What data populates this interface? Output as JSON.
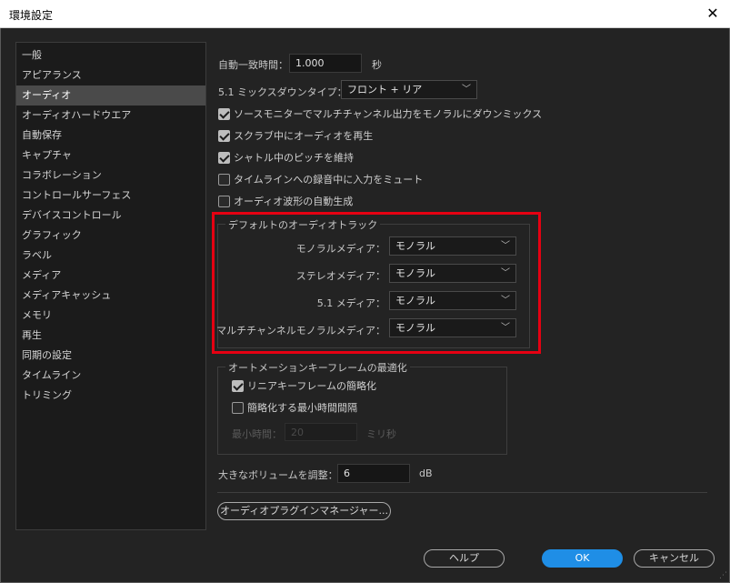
{
  "window": {
    "title": "環境設定",
    "close_glyph": "✕"
  },
  "sidebar": {
    "items": [
      {
        "label": "一般"
      },
      {
        "label": "アピアランス"
      },
      {
        "label": "オーディオ"
      },
      {
        "label": "オーディオハードウエア"
      },
      {
        "label": "自動保存"
      },
      {
        "label": "キャプチャ"
      },
      {
        "label": "コラボレーション"
      },
      {
        "label": "コントロールサーフェス"
      },
      {
        "label": "デバイスコントロール"
      },
      {
        "label": "グラフィック"
      },
      {
        "label": "ラベル"
      },
      {
        "label": "メディア"
      },
      {
        "label": "メディアキャッシュ"
      },
      {
        "label": "メモリ"
      },
      {
        "label": "再生"
      },
      {
        "label": "同期の設定"
      },
      {
        "label": "タイムライン"
      },
      {
        "label": "トリミング"
      }
    ],
    "selected": "オーディオ"
  },
  "audio": {
    "auto_match": {
      "label": "自動一致時間：",
      "value": "1.000",
      "unit": "秒"
    },
    "downmix": {
      "label": "5.1 ミックスダウンタイプ：",
      "value": "フロント + リア"
    },
    "checkboxes": [
      {
        "label": "ソースモニターでマルチチャンネル出力をモノラルにダウンミックス",
        "checked": true
      },
      {
        "label": "スクラブ中にオーディオを再生",
        "checked": true
      },
      {
        "label": "シャトル中のピッチを維持",
        "checked": true
      },
      {
        "label": "タイムラインへの録音中に入力をミュート",
        "checked": false
      },
      {
        "label": "オーディオ波形の自動生成",
        "checked": false
      }
    ],
    "default_tracks": {
      "title": "デフォルトのオーディオトラック",
      "rows": [
        {
          "label": "モノラルメディア：",
          "value": "モノラル"
        },
        {
          "label": "ステレオメディア：",
          "value": "モノラル"
        },
        {
          "label": "5.1 メディア：",
          "value": "モノラル"
        },
        {
          "label": "マルチチャンネルモノラルメディア：",
          "value": "モノラル"
        }
      ]
    },
    "automation": {
      "title": "オートメーションキーフレームの最適化",
      "linear": {
        "label": "リニアキーフレームの簡略化",
        "checked": true
      },
      "min_time": {
        "label": "簡略化する最小時間間隔",
        "checked": false
      },
      "min_time_field": {
        "label": "最小時間：",
        "value": "20",
        "unit": "ミリ秒"
      }
    },
    "volume": {
      "label": "大きなボリュームを調整：",
      "value": "6",
      "unit": "dB"
    },
    "plugin_manager_label": "オーディオプラグインマネージャー..."
  },
  "footer": {
    "help": "ヘルプ",
    "ok": "OK",
    "cancel": "キャンセル"
  },
  "colors": {
    "accent": "#1f8ee6",
    "highlight": "#e60012",
    "background": "#232323"
  }
}
